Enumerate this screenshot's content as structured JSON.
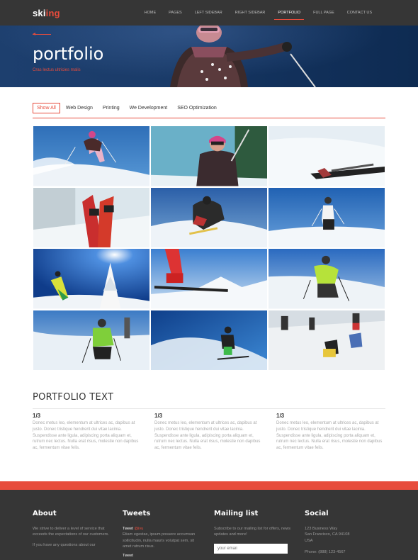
{
  "brand": {
    "logo_part1": "ski",
    "logo_part2": "ing",
    "accent": "#e74c3c",
    "dark": "#363636"
  },
  "nav": {
    "items": [
      {
        "label": "HOME",
        "active": false
      },
      {
        "label": "PAGES",
        "active": false
      },
      {
        "label": "LEFT SIDEBAR",
        "active": false
      },
      {
        "label": "RIGHT SIDEBAR",
        "active": false
      },
      {
        "label": "PORTFOLIO",
        "active": true
      },
      {
        "label": "FULL PAGE",
        "active": false
      },
      {
        "label": "CONTACT US",
        "active": false
      }
    ]
  },
  "hero": {
    "title": "portfolio",
    "subtitle": "Cras lectus ultricies malis"
  },
  "filters": [
    "Show All",
    "Web Design",
    "Printing",
    "We Development",
    "SEO Optimization"
  ],
  "active_filter": "Show All",
  "portfolio": {
    "title": "PORTFOLIO TEXT",
    "columns": [
      {
        "heading": "1/3",
        "text": "Donec metus leo, elementum at ultrices ac, dapibus at justo. Donec tristique hendrerit dui vitae lacinia. Suspendisse ante ligula, adipiscing porta aliquam et, rutrum nec lectus. Nulla erat risus, molestie non dapibus ac, fermentum vitae felis."
      },
      {
        "heading": "1/3",
        "text": "Donec metus leo, elementum at ultrices ac, dapibus at justo. Donec tristique hendrerit dui vitae lacinia. Suspendisse ante ligula, adipiscing porta aliquam et, rutrum nec lectus. Nulla erat risus, molestie non dapibus ac, fermentum vitae felis."
      },
      {
        "heading": "1/3",
        "text": "Donec metus leo, elementum at ultrices ac, dapibus at justo. Donec tristique hendrerit dui vitae lacinia. Suspendisse ante ligula, adipiscing porta aliquam et, rutrum nec lectus. Nulla erat risus, molestie non dapibus ac, fermentum vitae felis."
      }
    ]
  },
  "footer": {
    "about": {
      "title": "About",
      "text1": "We strive to deliver a level of service that exceeds the expectations of our customers.",
      "text2": "If you have any questions about our"
    },
    "tweets": {
      "title": "Tweets",
      "tweet_label": "Tweet",
      "handle": "@ivu",
      "text": "Etiam egestas, ipsum posuere accumsan sollicitudin, nulla mauris volutpat sem, sit amet rutrum risus.",
      "tweet2_label": "Tweet"
    },
    "mailing": {
      "title": "Mailing list",
      "text": "Subscribe to our mailing list for offers, news updates and more!",
      "placeholder": "your email"
    },
    "social": {
      "title": "Social",
      "address1": "123 Business Way",
      "address2": "San Francisco, CA 94108",
      "address3": "USA",
      "phone": "Phone: (888) 123-4567"
    }
  }
}
